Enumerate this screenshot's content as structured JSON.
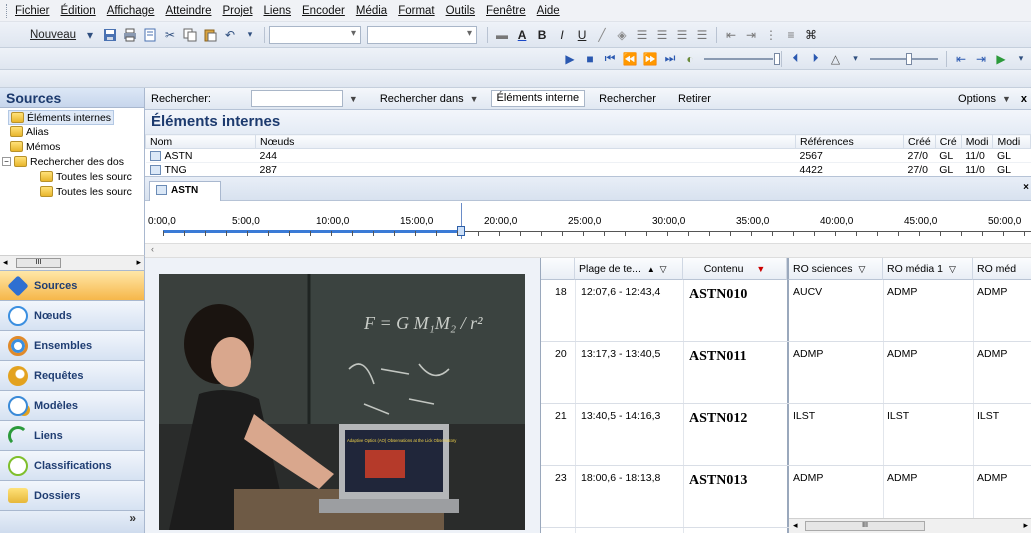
{
  "menu": [
    "Fichier",
    "Édition",
    "Affichage",
    "Atteindre",
    "Projet",
    "Liens",
    "Encoder",
    "Média",
    "Format",
    "Outils",
    "Fenêtre",
    "Aide"
  ],
  "toolbar": {
    "nouveau_label": "Nouveau"
  },
  "sources": {
    "title": "Sources",
    "tree": [
      {
        "label": "Éléments internes",
        "icon": "folder-yellow-icon"
      },
      {
        "label": "Alias",
        "icon": "folder-yellow-icon"
      },
      {
        "label": "Mémos",
        "icon": "folder-yellow-icon"
      },
      {
        "label": "Rechercher des dos",
        "icon": "folder-open-icon"
      },
      {
        "label": "Toutes les sourc",
        "icon": "folder-yellow-icon"
      },
      {
        "label": "Toutes les sourc",
        "icon": "folder-yellow-icon"
      }
    ],
    "scroll_label": "III"
  },
  "nav": [
    {
      "label": "Sources",
      "icon": "sources-icon",
      "color": "#2f6fd1"
    },
    {
      "label": "Nœuds",
      "icon": "nodes-icon",
      "color": "#3b8fe0"
    },
    {
      "label": "Ensembles",
      "icon": "sets-icon",
      "color": "#e08a2a"
    },
    {
      "label": "Requêtes",
      "icon": "queries-icon",
      "color": "#e3a21f"
    },
    {
      "label": "Modèles",
      "icon": "models-icon",
      "color": "#3a8ad8"
    },
    {
      "label": "Liens",
      "icon": "links-icon",
      "color": "#2c9a3b"
    },
    {
      "label": "Classifications",
      "icon": "classifications-icon",
      "color": "#7fbf2c"
    },
    {
      "label": "Dossiers",
      "icon": "folders-icon",
      "color": "#e6b73a"
    }
  ],
  "search": {
    "rechercher_label": "Rechercher:",
    "rechercher_dans_label": "Rechercher dans",
    "scope_value": "Éléments interne",
    "search_button": "Rechercher",
    "clear_button": "Retirer",
    "options_label": "Options",
    "close_label": "x"
  },
  "internals": {
    "title": "Éléments internes",
    "headers": [
      "Nom",
      "Nœuds",
      "Références",
      "Créé",
      "Cré",
      "Modi",
      "Modi"
    ],
    "rows": [
      [
        "ASTN",
        "244",
        "2567",
        "27/0",
        "GL",
        "11/0",
        "GL"
      ],
      [
        "TNG",
        "287",
        "4422",
        "27/0",
        "GL",
        "11/0",
        "GL"
      ]
    ]
  },
  "tab": {
    "label": "ASTN"
  },
  "timeline": {
    "ticks": [
      "0:00,0",
      "5:00,0",
      "10:00,0",
      "15:00,0",
      "20:00,0",
      "25:00,0",
      "30:00,0",
      "35:00,0",
      "40:00,0",
      "45:00,0",
      "50:00,0"
    ],
    "scroll_left_label": "‹"
  },
  "video": {
    "board_text": "F = G M₁M₂ / r²",
    "laptop_title": "Adaptive Optics (AO) Observations at the Lick Observatory"
  },
  "grid": {
    "headers": [
      "Plage de te...",
      "Contenu",
      "RO sciences",
      "RO média 1",
      "RO méd"
    ],
    "rows": [
      {
        "num": "18",
        "range": "12:07,6 - 12:43,4",
        "content": "ASTN010",
        "ro1": "AUCV",
        "ro2": "ADMP",
        "ro3": "ADMP"
      },
      {
        "num": "20",
        "range": "13:17,3 - 13:40,5",
        "content": "ASTN011",
        "ro1": "ADMP",
        "ro2": "ADMP",
        "ro3": "ADMP"
      },
      {
        "num": "21",
        "range": "13:40,5 - 14:16,3",
        "content": "ASTN012",
        "ro1": "ILST",
        "ro2": "ILST",
        "ro3": "ILST"
      },
      {
        "num": "23",
        "range": "18:00,6 - 18:13,8",
        "content": "ASTN013",
        "ro1": "ADMP",
        "ro2": "ADMP",
        "ro3": "ADMP"
      }
    ],
    "hscroll_label": "III"
  }
}
